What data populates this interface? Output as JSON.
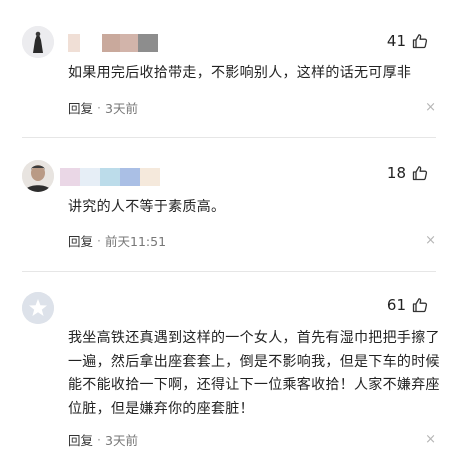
{
  "comments": [
    {
      "likes": "41",
      "text": "如果用完后收拾带走，不影响别人，这样的话无可厚非",
      "reply_label": "回复",
      "dot": "·",
      "time": "3天前",
      "close_glyph": "×",
      "mosaic_colors": [
        "#f0dfd6",
        "#ffffff",
        "#c9a99c",
        "#d2b4aa",
        "#8d8d8d"
      ]
    },
    {
      "likes": "18",
      "text": "讲究的人不等于素质高。",
      "reply_label": "回复",
      "dot": "·",
      "time": "前天11:51",
      "close_glyph": "×",
      "mosaic_colors": [
        "#ead7e6",
        "#e6eef6",
        "#bcdcea",
        "#aabfe5",
        "#f5e9dc"
      ]
    },
    {
      "likes": "61",
      "text": "我坐高铁还真遇到这样的一个女人，首先有湿巾把把手擦了一遍，然后拿出座套套上，倒是不影响我，但是下车的时候能不能收拾一下啊，还得让下一位乘客收拾！人家不嫌弃座位脏，但是嫌弃你的座套脏！",
      "reply_label": "回复",
      "dot": "·",
      "time": "3天前",
      "close_glyph": "×",
      "mosaic_colors": []
    }
  ],
  "colors": {
    "text": "#222222",
    "meta": "#777777",
    "divider": "#e6e6e6"
  }
}
